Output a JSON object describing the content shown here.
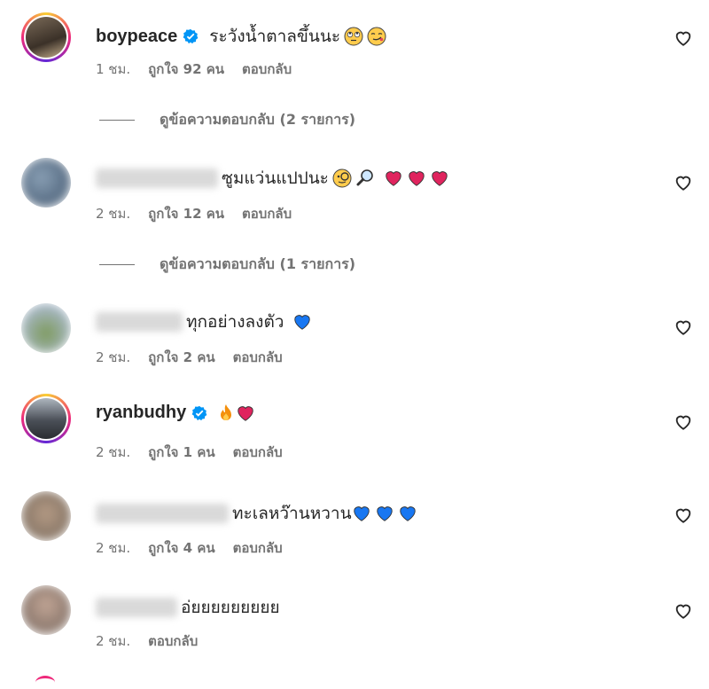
{
  "comments": [
    {
      "username": "boypeace",
      "verified": true,
      "text": "ระวังน้ำตาลขึ้นนะ",
      "emojis": [
        "rolling-eyes-emoji",
        "smirk-emoji"
      ],
      "time": "1 ชม.",
      "likes": "ถูกใจ 92 คน",
      "reply": "ตอบกลับ",
      "view_replies": "ดูข้อความตอบกลับ (2 รายการ)"
    },
    {
      "username": "",
      "verified": false,
      "text": "ซูมแว่นแปปนะ",
      "emojis": [
        "monocle-emoji",
        "magnifier-emoji",
        "red-heart",
        "red-heart",
        "red-heart"
      ],
      "time": "2 ชม.",
      "likes": "ถูกใจ 12 คน",
      "reply": "ตอบกลับ",
      "view_replies": "ดูข้อความตอบกลับ (1 รายการ)"
    },
    {
      "username": "",
      "verified": false,
      "text": "ทุกอย่างลงตัว",
      "emojis": [
        "blue-heart"
      ],
      "time": "2 ชม.",
      "likes": "ถูกใจ 2 คน",
      "reply": "ตอบกลับ"
    },
    {
      "username": "ryanbudhy",
      "verified": true,
      "text": "",
      "emojis": [
        "fire-emoji",
        "red-heart"
      ],
      "time": "2 ชม.",
      "likes": "ถูกใจ 1 คน",
      "reply": "ตอบกลับ"
    },
    {
      "username": "",
      "verified": false,
      "text": "ทะเลหว๊านหวาน",
      "emojis": [
        "blue-heart",
        "blue-heart",
        "blue-heart"
      ],
      "time": "2 ชม.",
      "likes": "ถูกใจ 4 คน",
      "reply": "ตอบกลับ"
    },
    {
      "username": "",
      "verified": false,
      "text": "อ่ยยยยยยยยย",
      "emojis": [],
      "time": "2 ชม.",
      "reply": "ตอบกลับ"
    }
  ],
  "colors": {
    "verified": "#0095f6",
    "muted": "#737373",
    "red_heart": "#e0245e",
    "blue_heart": "#1877f2"
  }
}
